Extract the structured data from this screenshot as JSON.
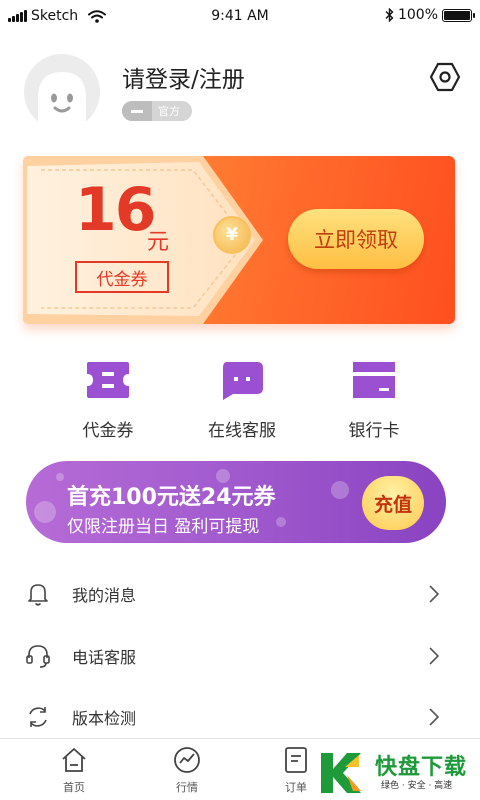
{
  "status_bar": {
    "carrier": "Sketch",
    "time": "9:41 AM",
    "battery": "100%",
    "battery_level": 1.0
  },
  "profile": {
    "username": "请登录/注册",
    "badge": "官方"
  },
  "coupon": {
    "amount": "16",
    "unit": "元",
    "label": "代金券",
    "currency_symbol": "¥",
    "claim_button": "立即领取"
  },
  "quick_actions": [
    {
      "label": "代金券",
      "icon": "voucher-icon",
      "color": "#9b4fd1"
    },
    {
      "label": "在线客服",
      "icon": "chat-icon",
      "color": "#9b4fd1"
    },
    {
      "label": "银行卡",
      "icon": "bank-card-icon",
      "color": "#9b4fd1"
    }
  ],
  "recharge": {
    "title": "首充100元送24元券",
    "subtitle": "仅限注册当日  盈利可提现",
    "button": "充值"
  },
  "menu": [
    {
      "label": "我的消息",
      "icon": "bell-icon"
    },
    {
      "label": "电话客服",
      "icon": "headset-icon"
    },
    {
      "label": "版本检测",
      "icon": "refresh-icon"
    }
  ],
  "tabs": [
    {
      "label": "首页",
      "icon": "home-icon"
    },
    {
      "label": "行情",
      "icon": "chart-icon"
    },
    {
      "label": "订单",
      "icon": "order-icon"
    }
  ],
  "watermark": {
    "title": "快盘下载",
    "subtitle": "绿色 · 安全 · 高速"
  },
  "colors": {
    "accent_purple": "#9b4fd1",
    "coupon_orange": "#ff6f2d",
    "coupon_red": "#e23a26",
    "button_gold": "#ffbf43"
  }
}
